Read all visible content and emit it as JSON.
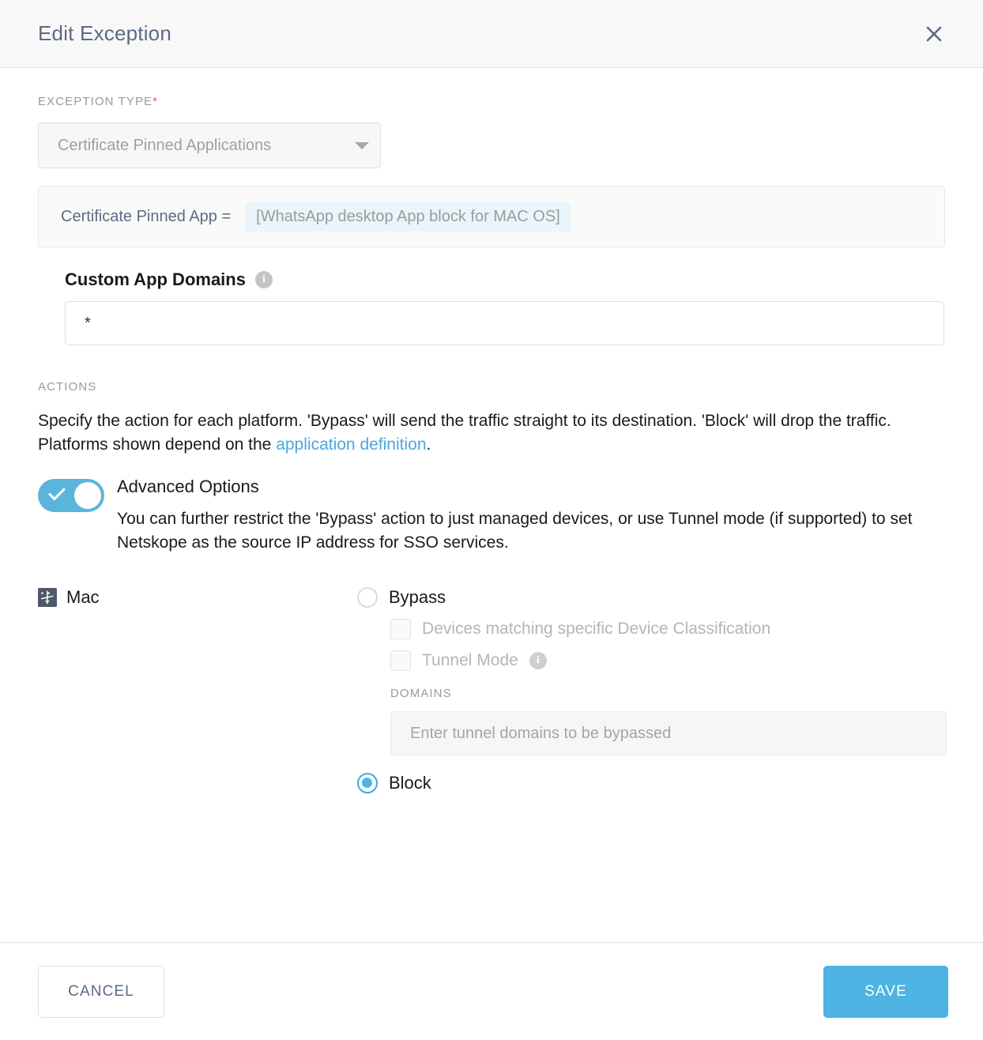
{
  "header": {
    "title": "Edit Exception",
    "close_icon": "close-icon"
  },
  "exception_type": {
    "label": "EXCEPTION TYPE",
    "required_marker": "*",
    "selected": "Certificate Pinned Applications",
    "caret_icon": "chevron-down-icon"
  },
  "filter": {
    "key": "Certificate Pinned App =",
    "chip": "[WhatsApp desktop App block for MAC OS]"
  },
  "custom_app_domains": {
    "title": "Custom App Domains",
    "info_icon": "info-icon",
    "value": "*",
    "placeholder": ""
  },
  "actions": {
    "label": "ACTIONS",
    "description_part1": "Specify the action for each platform. 'Bypass' will send the traffic straight to its destination. 'Block' will drop the traffic. Platforms shown depend on the ",
    "link_text": "application definition",
    "description_part2": "."
  },
  "advanced_options": {
    "enabled": true,
    "toggle_icon": "check-icon",
    "title": "Advanced Options",
    "description": "You can further restrict the 'Bypass' action to just managed devices, or use Tunnel mode (if supported) to set Netskope as the source IP address for SSO services."
  },
  "platform": {
    "name": "Mac",
    "icon": "mac-finder-icon",
    "options": {
      "bypass": {
        "label": "Bypass",
        "selected": false
      },
      "device_classification": {
        "label": "Devices matching specific Device Classification",
        "checked": false,
        "disabled": true
      },
      "tunnel_mode": {
        "label": "Tunnel Mode",
        "info_icon": "info-icon",
        "checked": false,
        "disabled": true
      },
      "domains": {
        "label": "DOMAINS",
        "placeholder": "Enter tunnel domains to be bypassed",
        "value": "",
        "disabled": true
      },
      "block": {
        "label": "Block",
        "selected": true
      }
    }
  },
  "footer": {
    "cancel_label": "CANCEL",
    "save_label": "SAVE"
  },
  "colors": {
    "accent": "#4db4e3",
    "toggle_on": "#5bb4dc",
    "link": "#4aa8dd",
    "title": "#5b6b82",
    "required": "#e2574c",
    "chip_bg": "#e9f5fb",
    "mac_icon": "#4e5a6b"
  }
}
